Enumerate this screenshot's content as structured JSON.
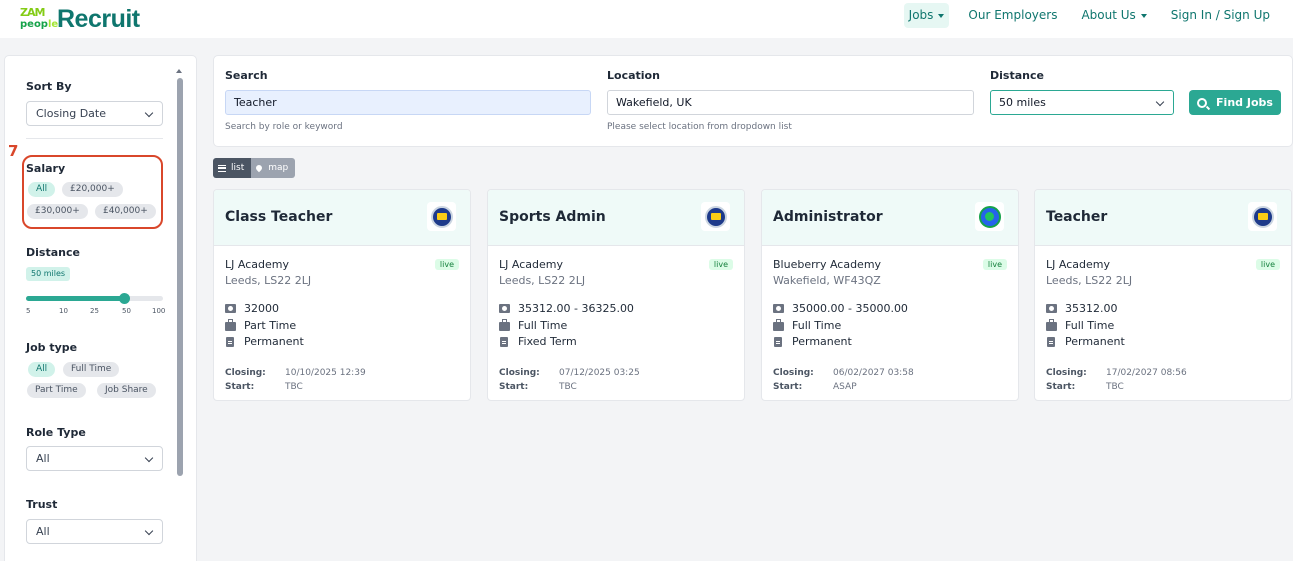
{
  "header": {
    "logo_top": "ZAM",
    "logo_bottom_a": "peop",
    "logo_bottom_b": "le",
    "logo_word": "Recruit",
    "nav": [
      {
        "label": "Jobs",
        "has_caret": true
      },
      {
        "label": "Our Employers",
        "has_caret": false
      },
      {
        "label": "About Us",
        "has_caret": true
      },
      {
        "label": "Sign In / Sign Up",
        "has_caret": false
      }
    ]
  },
  "sidebar": {
    "sort_by_label": "Sort By",
    "sort_by_value": "Closing Date",
    "annotation_number": "7",
    "salary_label": "Salary",
    "salary_chips": [
      "All",
      "£20,000+",
      "£30,000+",
      "£40,000+"
    ],
    "distance_label": "Distance",
    "distance_value": "50 miles",
    "distance_level": 50,
    "distance_ticks": [
      "5",
      "10",
      "25",
      "50",
      "100"
    ],
    "job_type_label": "Job type",
    "job_type_chips": [
      "All",
      "Full Time",
      "Part Time",
      "Job Share"
    ],
    "role_type_label": "Role Type",
    "role_type_value": "All",
    "trust_label": "Trust",
    "trust_value": "All"
  },
  "search": {
    "search_label": "Search",
    "search_value": "Teacher",
    "search_help": "Search by role or keyword",
    "location_label": "Location",
    "location_value": "Wakefield, UK",
    "location_help": "Please select location from dropdown list",
    "distance_label": "Distance",
    "distance_value": "50 miles",
    "find_label": "Find Jobs"
  },
  "view_toggle": {
    "list_label": "list",
    "map_label": "map"
  },
  "jobs": [
    {
      "title": "Class Teacher",
      "school": "LJ Academy",
      "address": "Leeds, LS22 2LJ",
      "status": "live",
      "salary": "32000",
      "hours": "Part Time",
      "contract": "Permanent",
      "closing_label": "Closing:",
      "closing": "10/10/2025 12:39",
      "start_label": "Start:",
      "start": "TBC"
    },
    {
      "title": "Sports Admin",
      "school": "LJ Academy",
      "address": "Leeds, LS22 2LJ",
      "status": "live",
      "salary": "35312.00 - 36325.00",
      "hours": "Full Time",
      "contract": "Fixed Term",
      "closing_label": "Closing:",
      "closing": "07/12/2025 03:25",
      "start_label": "Start:",
      "start": "TBC"
    },
    {
      "title": "Administrator",
      "school": "Blueberry Academy",
      "address": "Wakefield, WF43QZ",
      "status": "live",
      "salary": "35000.00 - 35000.00",
      "hours": "Full Time",
      "contract": "Permanent",
      "closing_label": "Closing:",
      "closing": "06/02/2027 03:58",
      "start_label": "Start:",
      "start": "ASAP"
    },
    {
      "title": "Teacher",
      "school": "LJ Academy",
      "address": "Leeds, LS22 2LJ",
      "status": "live",
      "salary": "35312.00",
      "hours": "Full Time",
      "contract": "Permanent",
      "closing_label": "Closing:",
      "closing": "17/02/2027 08:56",
      "start_label": "Start:",
      "start": "TBC"
    }
  ],
  "colors": {
    "brand": "#0f766e",
    "accent": "#2ba893",
    "annotation": "#d9472b"
  }
}
